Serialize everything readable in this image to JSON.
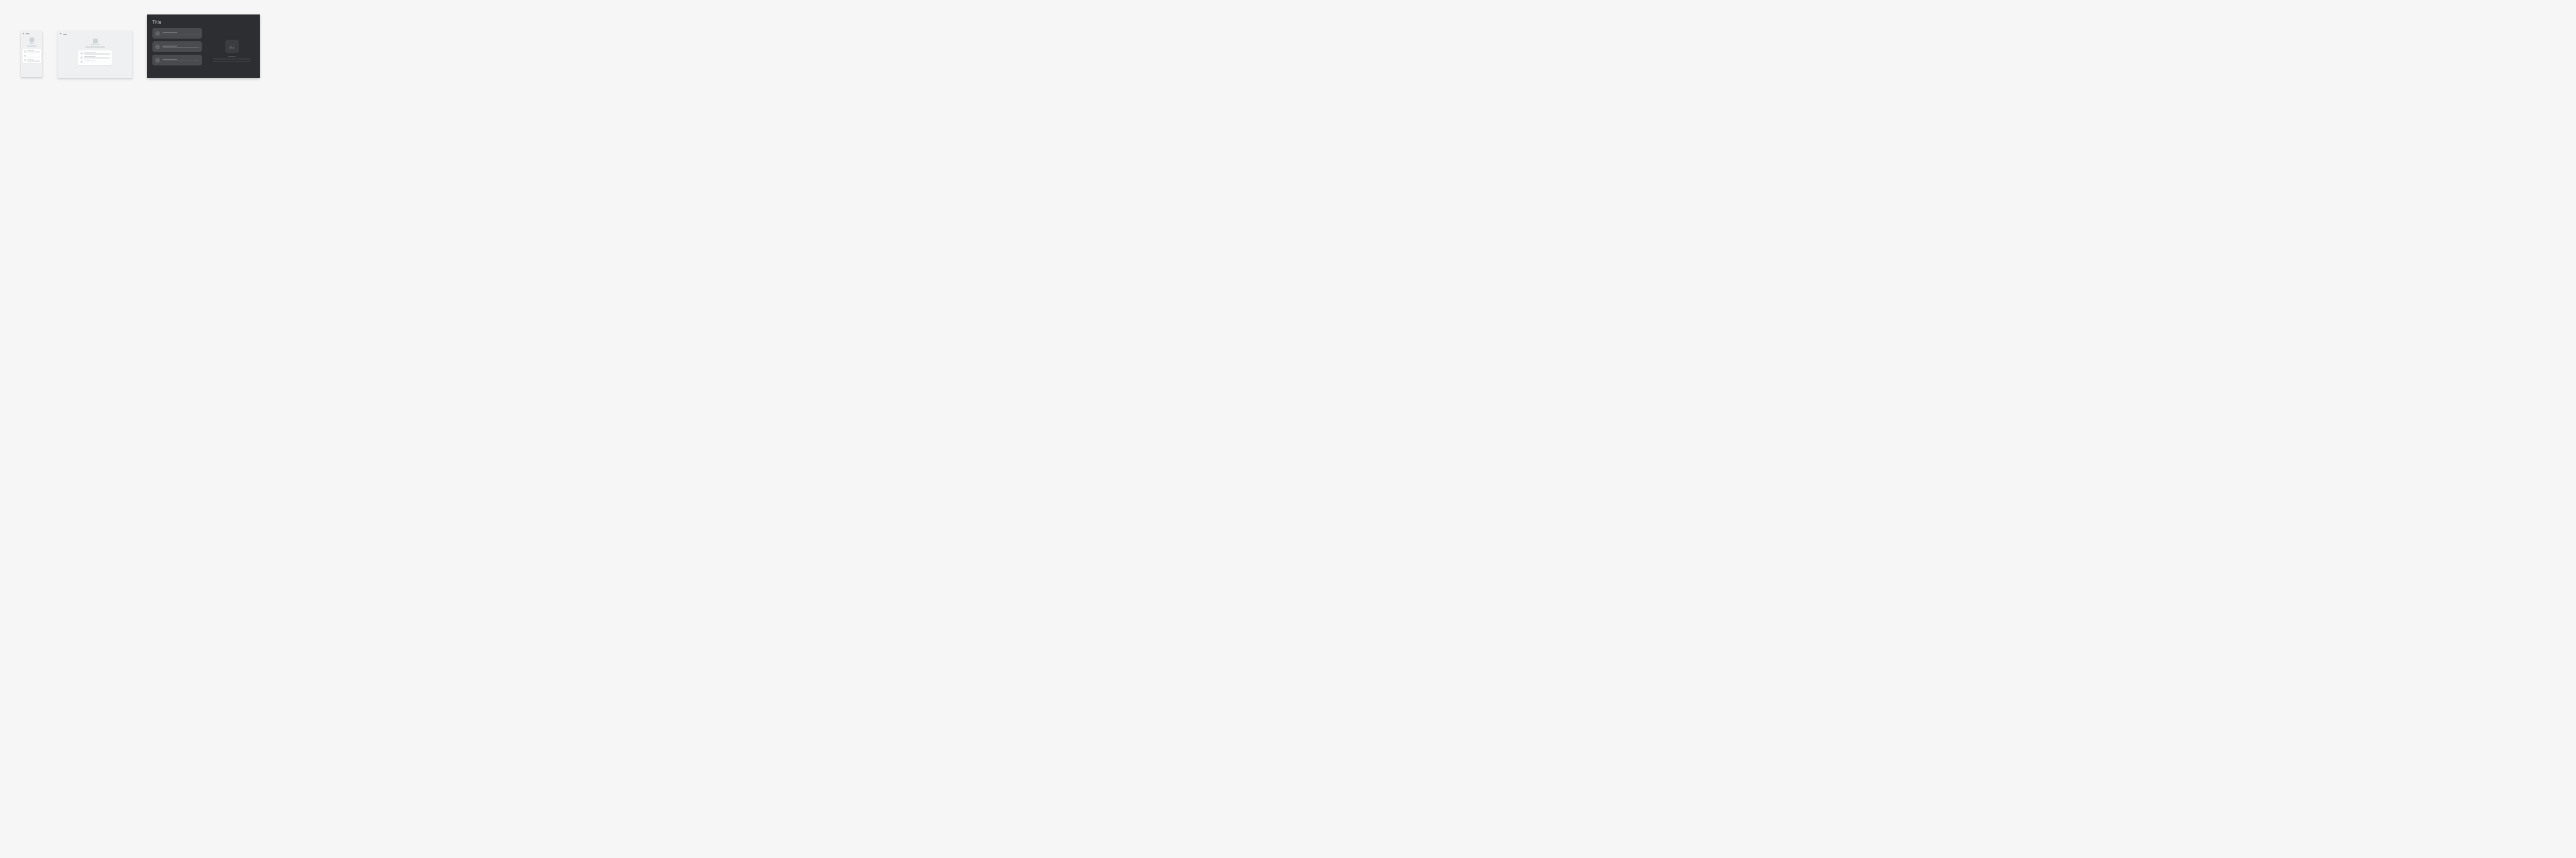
{
  "mobile": {
    "title": "Title",
    "list_items": [
      {},
      {},
      {}
    ]
  },
  "tablet": {
    "title": "Title",
    "list_items": [
      {},
      {},
      {}
    ]
  },
  "tv": {
    "title": "Title",
    "list_items": [
      {},
      {},
      {}
    ]
  }
}
